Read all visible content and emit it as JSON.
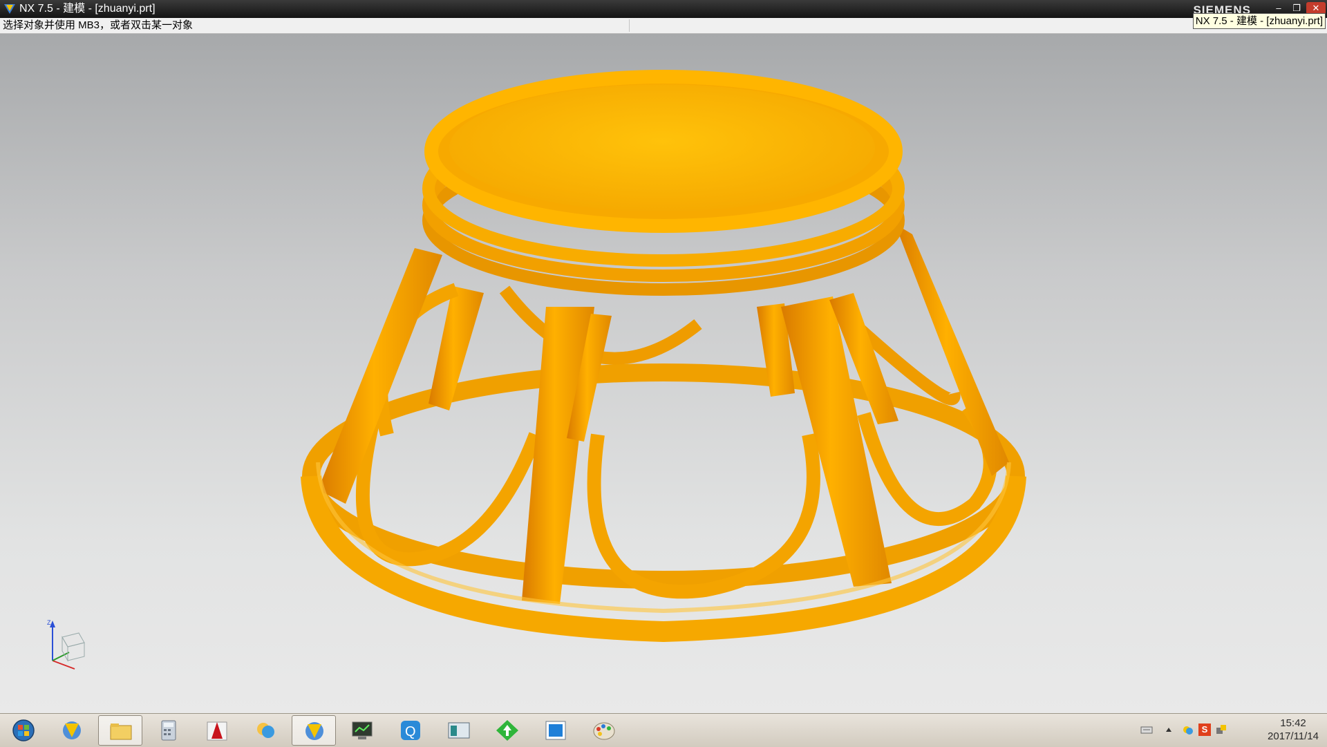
{
  "window": {
    "title": "NX 7.5 - 建模 - [zhuanyi.prt]",
    "brand": "SIEMENS",
    "minimize_glyph": "–",
    "maximize_glyph": "❐",
    "close_glyph": "✕"
  },
  "cue_line": {
    "prompt": "选择对象并使用 MB3，或者双击某一对象"
  },
  "tooltip": {
    "text": "NX 7.5 - 建模 - [zhuanyi.prt]"
  },
  "viewport": {
    "model_color": "#f5a300",
    "triad_axis_label": "Z"
  },
  "taskbar": {
    "items": [
      {
        "icon": "windows-start-orb-icon",
        "active": false
      },
      {
        "icon": "nx-app-icon",
        "active": false
      },
      {
        "icon": "file-explorer-folder-icon",
        "active": true
      },
      {
        "icon": "calculator-icon",
        "active": false
      },
      {
        "icon": "autocad-icon",
        "active": false
      },
      {
        "icon": "messenger-cloud-icon",
        "active": false
      },
      {
        "icon": "nx-app-icon",
        "active": true
      },
      {
        "icon": "monitor-terminal-icon",
        "active": false
      },
      {
        "icon": "qq-browser-icon",
        "active": false
      },
      {
        "icon": "window-panel-icon",
        "active": false
      },
      {
        "icon": "green-diamond-download-icon",
        "active": false
      },
      {
        "icon": "blue-square-app-icon",
        "active": false
      },
      {
        "icon": "paint-palette-icon",
        "active": false
      }
    ]
  },
  "tray": {
    "icons": [
      "keyboard-icon",
      "show-hidden-icons-arrow-icon",
      "network-cloud-icon",
      "sogou-input-icon",
      "flag-network-icon"
    ],
    "sogou_label": "S",
    "time": "15:42",
    "date": "2017/11/14"
  }
}
